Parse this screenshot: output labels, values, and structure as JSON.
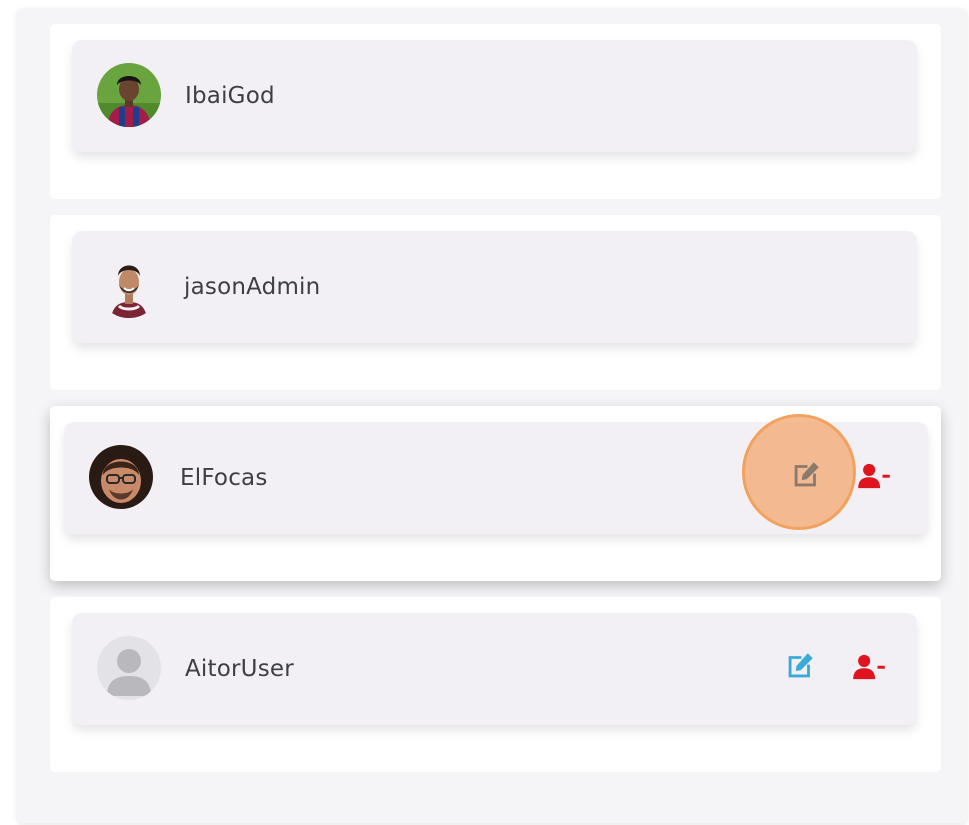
{
  "users": [
    {
      "name": "IbaiGod",
      "avatar": "footballer-photo-blaugrana",
      "actions": []
    },
    {
      "name": "jasonAdmin",
      "avatar": "footballer-photo-claret",
      "actions": []
    },
    {
      "name": "ElFocas",
      "avatar": "man-with-glasses-photo",
      "actions": [
        "edit-icon",
        "remove-user-icon"
      ]
    },
    {
      "name": "AitorUser",
      "avatar": "default-user-icon",
      "actions": [
        "edit-icon",
        "remove-user-icon"
      ]
    }
  ],
  "colors": {
    "edit_icon": "#3aaad8",
    "edit_icon_highlighted": "#8a7a6e",
    "remove_icon": "#e0141e",
    "click_highlight": "#f3b080"
  }
}
